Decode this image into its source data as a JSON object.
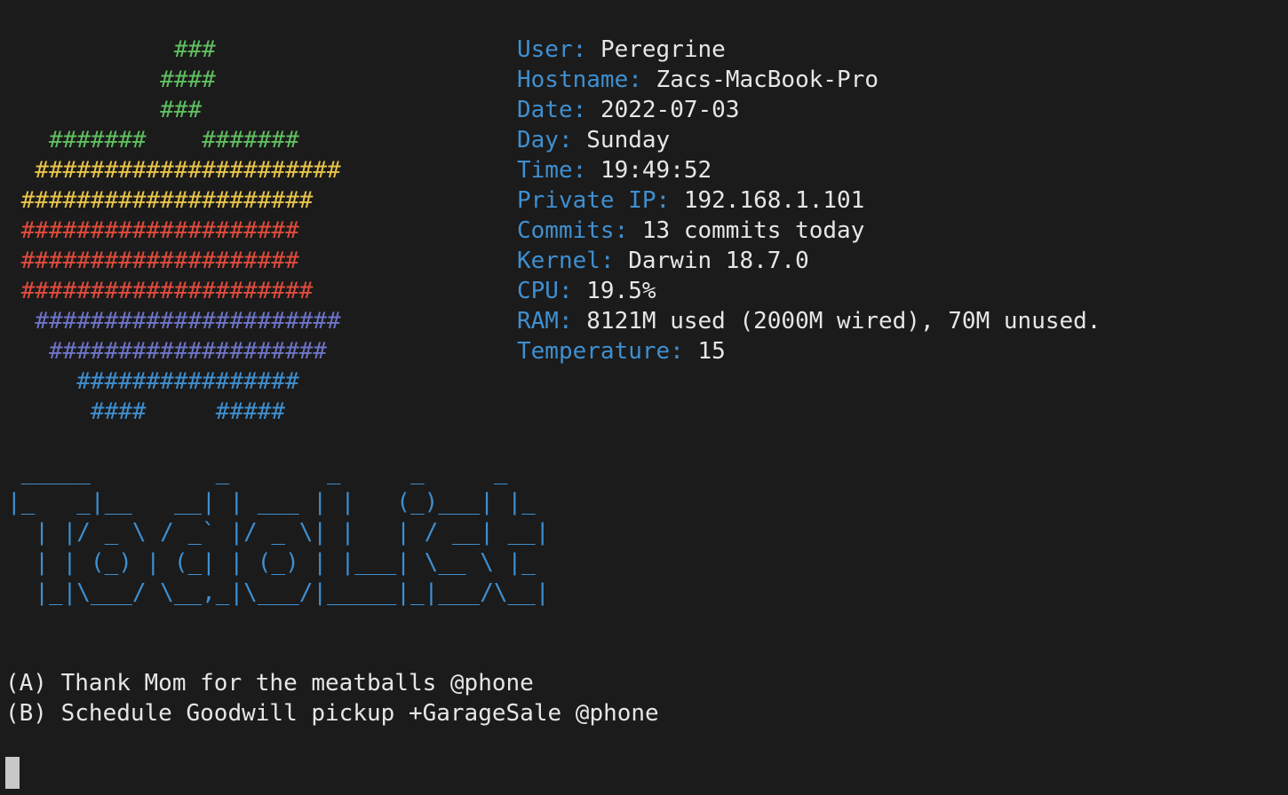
{
  "apple_logo": [
    {
      "text": "            ###",
      "color": "#5fbf5f"
    },
    {
      "text": "           ####",
      "color": "#5fbf5f"
    },
    {
      "text": "           ###",
      "color": "#5fbf5f"
    },
    {
      "text": "   #######    #######",
      "color": "#5fbf5f"
    },
    {
      "text": "  ######################",
      "color": "#e8c44a"
    },
    {
      "text": " #####################",
      "color": "#e8c44a"
    },
    {
      "text": " ####################",
      "color": "#e04b3c"
    },
    {
      "text": " ####################",
      "color": "#e04b3c"
    },
    {
      "text": " #####################",
      "color": "#e04b3c"
    },
    {
      "text": "  ######################",
      "color": "#6e74c8"
    },
    {
      "text": "   ####################",
      "color": "#6e74c8"
    },
    {
      "text": "     ################",
      "color": "#3f8fd0"
    },
    {
      "text": "      ####     #####",
      "color": "#3f8fd0"
    }
  ],
  "system_info": [
    {
      "key": "User:",
      "value": "Peregrine"
    },
    {
      "key": "Hostname:",
      "value": "Zacs-MacBook-Pro"
    },
    {
      "key": "Date:",
      "value": "2022-07-03"
    },
    {
      "key": "Day:",
      "value": "Sunday"
    },
    {
      "key": "Time:",
      "value": "19:49:52"
    },
    {
      "key": "Private IP:",
      "value": "192.168.1.101"
    },
    {
      "key": "Commits:",
      "value": "13 commits today"
    },
    {
      "key": "Kernel:",
      "value": "Darwin 18.7.0"
    },
    {
      "key": "CPU:",
      "value": "19.5%"
    },
    {
      "key": "RAM:",
      "value": "8121M used (2000M wired), 70M unused."
    },
    {
      "key": "Temperature:",
      "value": "15"
    }
  ],
  "banner": {
    "text": " _____         _       _     _     _\n|_   _|__   __| | ___ | |   (_)___| |_\n  | |/ _ \\ / _` |/ _ \\| |   | / __| __|\n  | | (_) | (_| | (_) | |___| \\__ \\ |_\n  |_|\\___/ \\__,_|\\___/|_____|_|___/\\__|",
    "color": "#3f8fd0"
  },
  "tasks": [
    "(A) Thank Mom for the meatballs @phone",
    "(B) Schedule Goodwill pickup +GarageSale @phone"
  ],
  "colors": {
    "background": "#1b1b1b",
    "foreground": "#e6e6e6",
    "label": "#3f8fd0"
  }
}
